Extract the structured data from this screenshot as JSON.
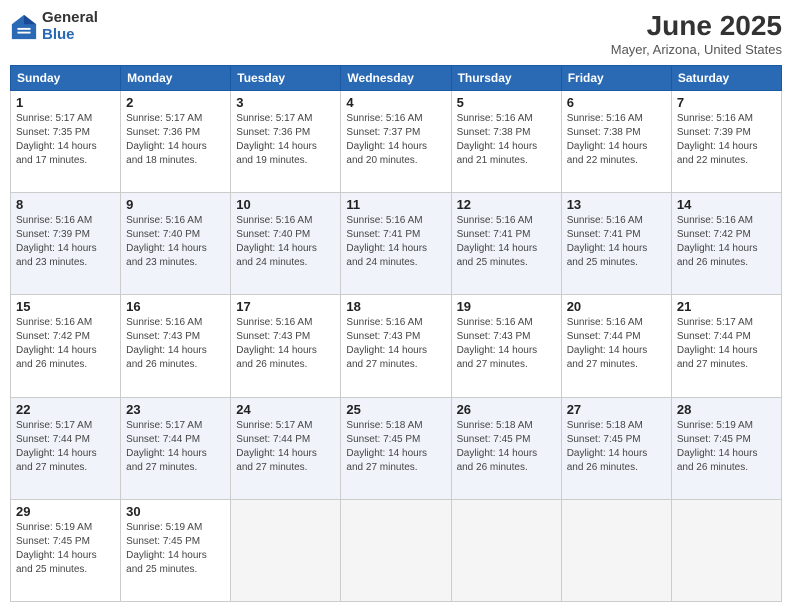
{
  "logo": {
    "general": "General",
    "blue": "Blue"
  },
  "title": "June 2025",
  "location": "Mayer, Arizona, United States",
  "days_of_week": [
    "Sunday",
    "Monday",
    "Tuesday",
    "Wednesday",
    "Thursday",
    "Friday",
    "Saturday"
  ],
  "weeks": [
    [
      {
        "day": "1",
        "info": "Sunrise: 5:17 AM\nSunset: 7:35 PM\nDaylight: 14 hours\nand 17 minutes."
      },
      {
        "day": "2",
        "info": "Sunrise: 5:17 AM\nSunset: 7:36 PM\nDaylight: 14 hours\nand 18 minutes."
      },
      {
        "day": "3",
        "info": "Sunrise: 5:17 AM\nSunset: 7:36 PM\nDaylight: 14 hours\nand 19 minutes."
      },
      {
        "day": "4",
        "info": "Sunrise: 5:16 AM\nSunset: 7:37 PM\nDaylight: 14 hours\nand 20 minutes."
      },
      {
        "day": "5",
        "info": "Sunrise: 5:16 AM\nSunset: 7:38 PM\nDaylight: 14 hours\nand 21 minutes."
      },
      {
        "day": "6",
        "info": "Sunrise: 5:16 AM\nSunset: 7:38 PM\nDaylight: 14 hours\nand 22 minutes."
      },
      {
        "day": "7",
        "info": "Sunrise: 5:16 AM\nSunset: 7:39 PM\nDaylight: 14 hours\nand 22 minutes."
      }
    ],
    [
      {
        "day": "8",
        "info": "Sunrise: 5:16 AM\nSunset: 7:39 PM\nDaylight: 14 hours\nand 23 minutes."
      },
      {
        "day": "9",
        "info": "Sunrise: 5:16 AM\nSunset: 7:40 PM\nDaylight: 14 hours\nand 23 minutes."
      },
      {
        "day": "10",
        "info": "Sunrise: 5:16 AM\nSunset: 7:40 PM\nDaylight: 14 hours\nand 24 minutes."
      },
      {
        "day": "11",
        "info": "Sunrise: 5:16 AM\nSunset: 7:41 PM\nDaylight: 14 hours\nand 24 minutes."
      },
      {
        "day": "12",
        "info": "Sunrise: 5:16 AM\nSunset: 7:41 PM\nDaylight: 14 hours\nand 25 minutes."
      },
      {
        "day": "13",
        "info": "Sunrise: 5:16 AM\nSunset: 7:41 PM\nDaylight: 14 hours\nand 25 minutes."
      },
      {
        "day": "14",
        "info": "Sunrise: 5:16 AM\nSunset: 7:42 PM\nDaylight: 14 hours\nand 26 minutes."
      }
    ],
    [
      {
        "day": "15",
        "info": "Sunrise: 5:16 AM\nSunset: 7:42 PM\nDaylight: 14 hours\nand 26 minutes."
      },
      {
        "day": "16",
        "info": "Sunrise: 5:16 AM\nSunset: 7:43 PM\nDaylight: 14 hours\nand 26 minutes."
      },
      {
        "day": "17",
        "info": "Sunrise: 5:16 AM\nSunset: 7:43 PM\nDaylight: 14 hours\nand 26 minutes."
      },
      {
        "day": "18",
        "info": "Sunrise: 5:16 AM\nSunset: 7:43 PM\nDaylight: 14 hours\nand 27 minutes."
      },
      {
        "day": "19",
        "info": "Sunrise: 5:16 AM\nSunset: 7:43 PM\nDaylight: 14 hours\nand 27 minutes."
      },
      {
        "day": "20",
        "info": "Sunrise: 5:16 AM\nSunset: 7:44 PM\nDaylight: 14 hours\nand 27 minutes."
      },
      {
        "day": "21",
        "info": "Sunrise: 5:17 AM\nSunset: 7:44 PM\nDaylight: 14 hours\nand 27 minutes."
      }
    ],
    [
      {
        "day": "22",
        "info": "Sunrise: 5:17 AM\nSunset: 7:44 PM\nDaylight: 14 hours\nand 27 minutes."
      },
      {
        "day": "23",
        "info": "Sunrise: 5:17 AM\nSunset: 7:44 PM\nDaylight: 14 hours\nand 27 minutes."
      },
      {
        "day": "24",
        "info": "Sunrise: 5:17 AM\nSunset: 7:44 PM\nDaylight: 14 hours\nand 27 minutes."
      },
      {
        "day": "25",
        "info": "Sunrise: 5:18 AM\nSunset: 7:45 PM\nDaylight: 14 hours\nand 27 minutes."
      },
      {
        "day": "26",
        "info": "Sunrise: 5:18 AM\nSunset: 7:45 PM\nDaylight: 14 hours\nand 26 minutes."
      },
      {
        "day": "27",
        "info": "Sunrise: 5:18 AM\nSunset: 7:45 PM\nDaylight: 14 hours\nand 26 minutes."
      },
      {
        "day": "28",
        "info": "Sunrise: 5:19 AM\nSunset: 7:45 PM\nDaylight: 14 hours\nand 26 minutes."
      }
    ],
    [
      {
        "day": "29",
        "info": "Sunrise: 5:19 AM\nSunset: 7:45 PM\nDaylight: 14 hours\nand 25 minutes."
      },
      {
        "day": "30",
        "info": "Sunrise: 5:19 AM\nSunset: 7:45 PM\nDaylight: 14 hours\nand 25 minutes."
      },
      {
        "day": "",
        "info": ""
      },
      {
        "day": "",
        "info": ""
      },
      {
        "day": "",
        "info": ""
      },
      {
        "day": "",
        "info": ""
      },
      {
        "day": "",
        "info": ""
      }
    ]
  ]
}
